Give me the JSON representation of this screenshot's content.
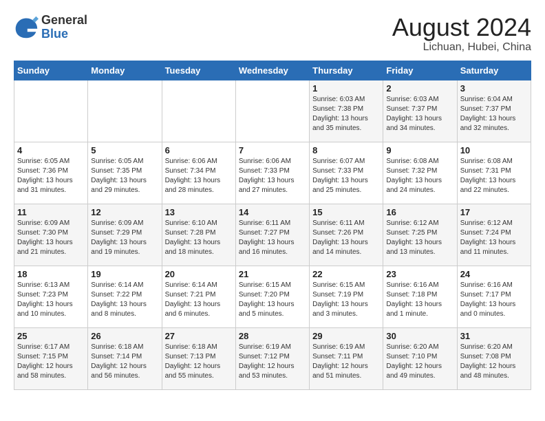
{
  "header": {
    "logo_general": "General",
    "logo_blue": "Blue",
    "title": "August 2024",
    "location": "Lichuan, Hubei, China"
  },
  "days_of_week": [
    "Sunday",
    "Monday",
    "Tuesday",
    "Wednesday",
    "Thursday",
    "Friday",
    "Saturday"
  ],
  "weeks": [
    [
      {
        "day": "",
        "info": ""
      },
      {
        "day": "",
        "info": ""
      },
      {
        "day": "",
        "info": ""
      },
      {
        "day": "",
        "info": ""
      },
      {
        "day": "1",
        "info": "Sunrise: 6:03 AM\nSunset: 7:38 PM\nDaylight: 13 hours\nand 35 minutes."
      },
      {
        "day": "2",
        "info": "Sunrise: 6:03 AM\nSunset: 7:37 PM\nDaylight: 13 hours\nand 34 minutes."
      },
      {
        "day": "3",
        "info": "Sunrise: 6:04 AM\nSunset: 7:37 PM\nDaylight: 13 hours\nand 32 minutes."
      }
    ],
    [
      {
        "day": "4",
        "info": "Sunrise: 6:05 AM\nSunset: 7:36 PM\nDaylight: 13 hours\nand 31 minutes."
      },
      {
        "day": "5",
        "info": "Sunrise: 6:05 AM\nSunset: 7:35 PM\nDaylight: 13 hours\nand 29 minutes."
      },
      {
        "day": "6",
        "info": "Sunrise: 6:06 AM\nSunset: 7:34 PM\nDaylight: 13 hours\nand 28 minutes."
      },
      {
        "day": "7",
        "info": "Sunrise: 6:06 AM\nSunset: 7:33 PM\nDaylight: 13 hours\nand 27 minutes."
      },
      {
        "day": "8",
        "info": "Sunrise: 6:07 AM\nSunset: 7:33 PM\nDaylight: 13 hours\nand 25 minutes."
      },
      {
        "day": "9",
        "info": "Sunrise: 6:08 AM\nSunset: 7:32 PM\nDaylight: 13 hours\nand 24 minutes."
      },
      {
        "day": "10",
        "info": "Sunrise: 6:08 AM\nSunset: 7:31 PM\nDaylight: 13 hours\nand 22 minutes."
      }
    ],
    [
      {
        "day": "11",
        "info": "Sunrise: 6:09 AM\nSunset: 7:30 PM\nDaylight: 13 hours\nand 21 minutes."
      },
      {
        "day": "12",
        "info": "Sunrise: 6:09 AM\nSunset: 7:29 PM\nDaylight: 13 hours\nand 19 minutes."
      },
      {
        "day": "13",
        "info": "Sunrise: 6:10 AM\nSunset: 7:28 PM\nDaylight: 13 hours\nand 18 minutes."
      },
      {
        "day": "14",
        "info": "Sunrise: 6:11 AM\nSunset: 7:27 PM\nDaylight: 13 hours\nand 16 minutes."
      },
      {
        "day": "15",
        "info": "Sunrise: 6:11 AM\nSunset: 7:26 PM\nDaylight: 13 hours\nand 14 minutes."
      },
      {
        "day": "16",
        "info": "Sunrise: 6:12 AM\nSunset: 7:25 PM\nDaylight: 13 hours\nand 13 minutes."
      },
      {
        "day": "17",
        "info": "Sunrise: 6:12 AM\nSunset: 7:24 PM\nDaylight: 13 hours\nand 11 minutes."
      }
    ],
    [
      {
        "day": "18",
        "info": "Sunrise: 6:13 AM\nSunset: 7:23 PM\nDaylight: 13 hours\nand 10 minutes."
      },
      {
        "day": "19",
        "info": "Sunrise: 6:14 AM\nSunset: 7:22 PM\nDaylight: 13 hours\nand 8 minutes."
      },
      {
        "day": "20",
        "info": "Sunrise: 6:14 AM\nSunset: 7:21 PM\nDaylight: 13 hours\nand 6 minutes."
      },
      {
        "day": "21",
        "info": "Sunrise: 6:15 AM\nSunset: 7:20 PM\nDaylight: 13 hours\nand 5 minutes."
      },
      {
        "day": "22",
        "info": "Sunrise: 6:15 AM\nSunset: 7:19 PM\nDaylight: 13 hours\nand 3 minutes."
      },
      {
        "day": "23",
        "info": "Sunrise: 6:16 AM\nSunset: 7:18 PM\nDaylight: 13 hours\nand 1 minute."
      },
      {
        "day": "24",
        "info": "Sunrise: 6:16 AM\nSunset: 7:17 PM\nDaylight: 13 hours\nand 0 minutes."
      }
    ],
    [
      {
        "day": "25",
        "info": "Sunrise: 6:17 AM\nSunset: 7:15 PM\nDaylight: 12 hours\nand 58 minutes."
      },
      {
        "day": "26",
        "info": "Sunrise: 6:18 AM\nSunset: 7:14 PM\nDaylight: 12 hours\nand 56 minutes."
      },
      {
        "day": "27",
        "info": "Sunrise: 6:18 AM\nSunset: 7:13 PM\nDaylight: 12 hours\nand 55 minutes."
      },
      {
        "day": "28",
        "info": "Sunrise: 6:19 AM\nSunset: 7:12 PM\nDaylight: 12 hours\nand 53 minutes."
      },
      {
        "day": "29",
        "info": "Sunrise: 6:19 AM\nSunset: 7:11 PM\nDaylight: 12 hours\nand 51 minutes."
      },
      {
        "day": "30",
        "info": "Sunrise: 6:20 AM\nSunset: 7:10 PM\nDaylight: 12 hours\nand 49 minutes."
      },
      {
        "day": "31",
        "info": "Sunrise: 6:20 AM\nSunset: 7:08 PM\nDaylight: 12 hours\nand 48 minutes."
      }
    ]
  ]
}
